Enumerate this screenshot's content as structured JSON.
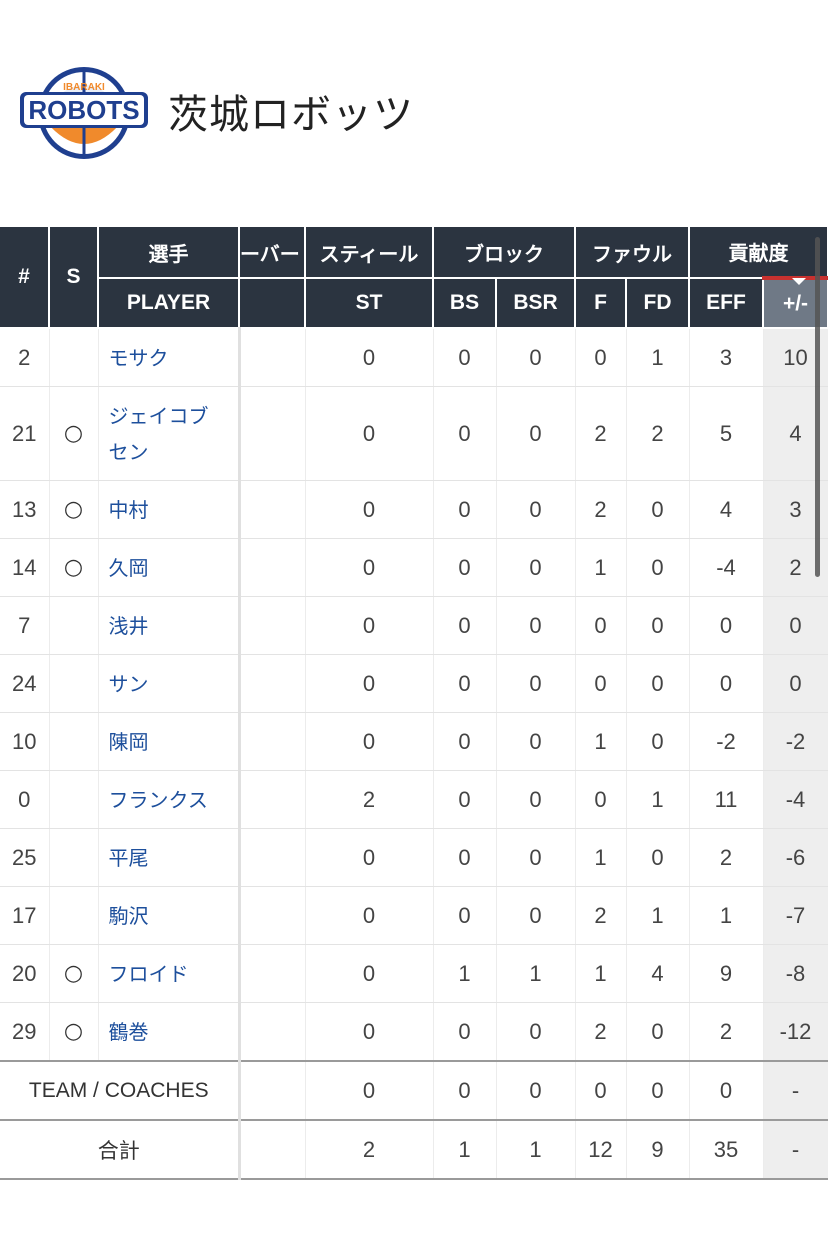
{
  "team": {
    "name": "茨城ロボッツ",
    "logo_text": "ROBOTS",
    "logo_subtext": "IBARAKI"
  },
  "colors": {
    "header_bg": "#2b3440",
    "accent_red": "#c8312f",
    "link_blue": "#1d4f9c",
    "pm_header_bg": "#6f7986"
  },
  "table": {
    "headers": {
      "number": "#",
      "starter": "S",
      "player_group": "選手",
      "player": "PLAYER",
      "clipped_group": "ーバー",
      "steal_group": "スティール",
      "steal": "ST",
      "block_group": "ブロック",
      "bs": "BS",
      "bsr": "BSR",
      "foul_group": "ファウル",
      "f": "F",
      "fd": "FD",
      "contrib_group": "貢献度",
      "eff": "EFF",
      "pm": "+/-"
    },
    "rows": [
      {
        "no": "2",
        "s": "",
        "name": "モサク",
        "st": "0",
        "bs": "0",
        "bsr": "0",
        "f": "0",
        "fd": "1",
        "eff": "3",
        "pm": "10"
      },
      {
        "no": "21",
        "s": "○",
        "name": "ジェイコブセン",
        "st": "0",
        "bs": "0",
        "bsr": "0",
        "f": "2",
        "fd": "2",
        "eff": "5",
        "pm": "4"
      },
      {
        "no": "13",
        "s": "○",
        "name": "中村",
        "st": "0",
        "bs": "0",
        "bsr": "0",
        "f": "2",
        "fd": "0",
        "eff": "4",
        "pm": "3"
      },
      {
        "no": "14",
        "s": "○",
        "name": "久岡",
        "st": "0",
        "bs": "0",
        "bsr": "0",
        "f": "1",
        "fd": "0",
        "eff": "-4",
        "pm": "2"
      },
      {
        "no": "7",
        "s": "",
        "name": "浅井",
        "st": "0",
        "bs": "0",
        "bsr": "0",
        "f": "0",
        "fd": "0",
        "eff": "0",
        "pm": "0"
      },
      {
        "no": "24",
        "s": "",
        "name": "サン",
        "st": "0",
        "bs": "0",
        "bsr": "0",
        "f": "0",
        "fd": "0",
        "eff": "0",
        "pm": "0"
      },
      {
        "no": "10",
        "s": "",
        "name": "陳岡",
        "st": "0",
        "bs": "0",
        "bsr": "0",
        "f": "1",
        "fd": "0",
        "eff": "-2",
        "pm": "-2"
      },
      {
        "no": "0",
        "s": "",
        "name": "フランクス",
        "st": "2",
        "bs": "0",
        "bsr": "0",
        "f": "0",
        "fd": "1",
        "eff": "11",
        "pm": "-4"
      },
      {
        "no": "25",
        "s": "",
        "name": "平尾",
        "st": "0",
        "bs": "0",
        "bsr": "0",
        "f": "1",
        "fd": "0",
        "eff": "2",
        "pm": "-6"
      },
      {
        "no": "17",
        "s": "",
        "name": "駒沢",
        "st": "0",
        "bs": "0",
        "bsr": "0",
        "f": "2",
        "fd": "1",
        "eff": "1",
        "pm": "-7"
      },
      {
        "no": "20",
        "s": "○",
        "name": "フロイド",
        "st": "0",
        "bs": "1",
        "bsr": "1",
        "f": "1",
        "fd": "4",
        "eff": "9",
        "pm": "-8"
      },
      {
        "no": "29",
        "s": "○",
        "name": "鶴巻",
        "st": "0",
        "bs": "0",
        "bsr": "0",
        "f": "2",
        "fd": "0",
        "eff": "2",
        "pm": "-12"
      }
    ],
    "team_row": {
      "label": "TEAM / COACHES",
      "st": "0",
      "bs": "0",
      "bsr": "0",
      "f": "0",
      "fd": "0",
      "eff": "0",
      "pm": "-"
    },
    "total_row": {
      "label": "合計",
      "st": "2",
      "bs": "1",
      "bsr": "1",
      "f": "12",
      "fd": "9",
      "eff": "35",
      "pm": "-"
    }
  }
}
